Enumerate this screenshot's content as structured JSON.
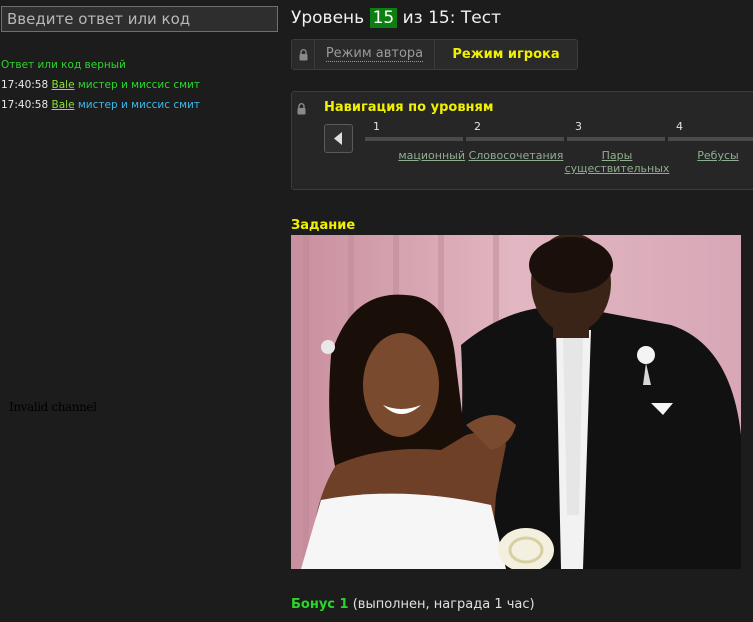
{
  "answer": {
    "placeholder": "Введите ответ или код",
    "value": ""
  },
  "log": {
    "status": "Ответ или код верный",
    "entries": [
      {
        "time": "17:40:58",
        "user": "Bale",
        "text": "мистер и миссис смит"
      },
      {
        "time": "17:40:58",
        "user": "Bale",
        "text": "мистер и миссис смит"
      }
    ]
  },
  "invalid_channel": "Invalid channel",
  "level": {
    "prefix": "Уровень",
    "current": "15",
    "of_text": "из 15: Тест"
  },
  "modes": {
    "author": "Режим автора",
    "player": "Режим игрока"
  },
  "nav": {
    "title": "Навигация по уровням",
    "levels": [
      {
        "num": "1",
        "name": "мационный"
      },
      {
        "num": "2",
        "name": "Словосочетания"
      },
      {
        "num": "3",
        "name": "Пары существительных"
      },
      {
        "num": "4",
        "name": "Ребусы"
      }
    ]
  },
  "task": {
    "title": "Задание"
  },
  "bonus": {
    "label": "Бонус 1",
    "detail": "(выполнен, награда 1 час)"
  },
  "colors": {
    "accent_yellow": "#f0f000",
    "success_green": "#2bd62b",
    "level_badge": "#0d7f12",
    "link_blue": "#3fb8e8"
  }
}
